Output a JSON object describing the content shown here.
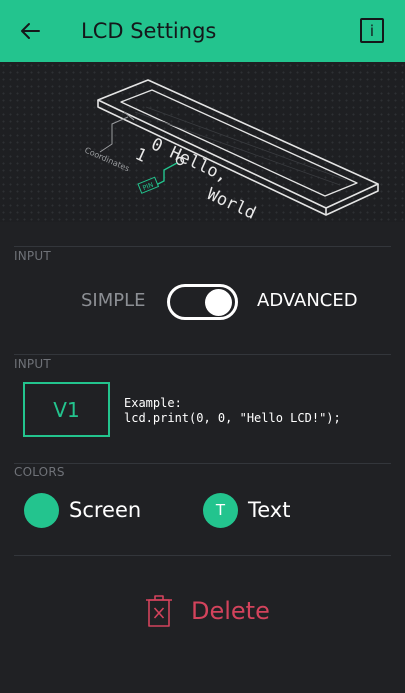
{
  "header": {
    "title": "LCD Settings",
    "back_icon": "arrow-left-icon",
    "info_icon": "info-icon",
    "info_glyph": "i",
    "color": "#23c48e"
  },
  "illustration": {
    "line1": "0 Hello,",
    "line2": "1",
    "line3": "World",
    "coordinates_label": "Coordinates",
    "pin_label": "PIN"
  },
  "mode_section": {
    "label": "INPUT",
    "left_option": "SIMPLE",
    "right_option": "ADVANCED",
    "selected": "ADVANCED"
  },
  "input_section": {
    "label": "INPUT",
    "pin": "V1",
    "example_title": "Example:",
    "example_code": "lcd.print(0, 0, \"Hello LCD!\");"
  },
  "colors_section": {
    "label": "COLORS",
    "items": [
      {
        "label": "Screen",
        "glyph": "",
        "color": "#23c48e"
      },
      {
        "label": "Text",
        "glyph": "T",
        "color": "#23c48e"
      }
    ]
  },
  "delete": {
    "label": "Delete",
    "icon": "trash-icon",
    "color": "#d3435c"
  }
}
